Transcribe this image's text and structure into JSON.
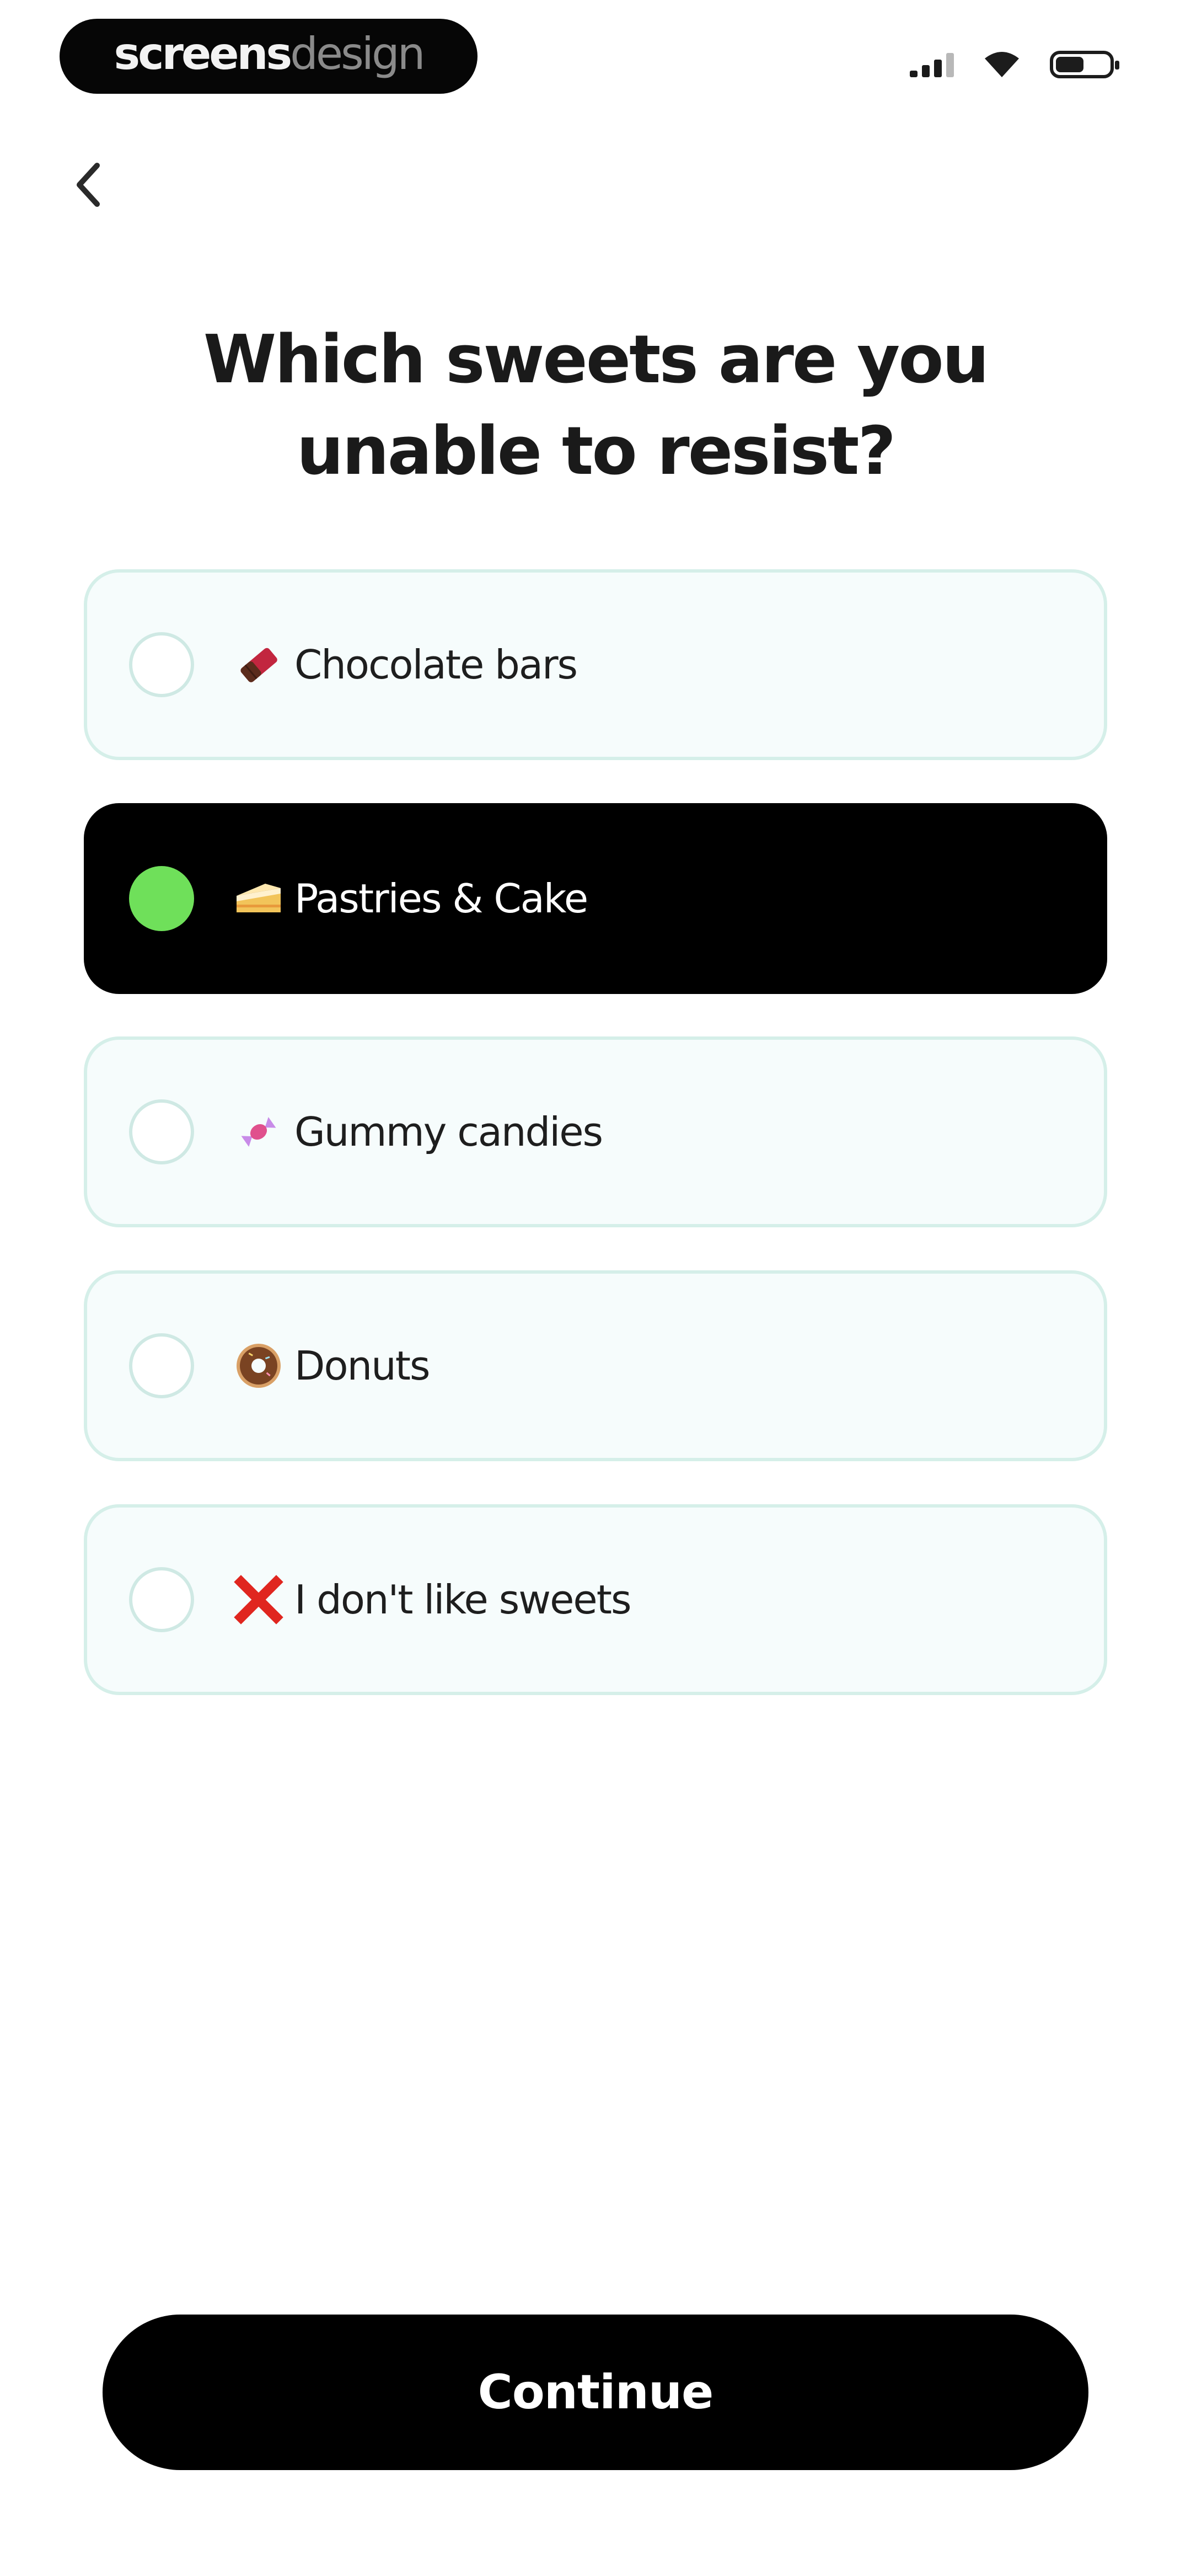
{
  "status_bar": {
    "brand_part1": "screens",
    "brand_part2": "design"
  },
  "question": "Which sweets are you unable to resist?",
  "options": [
    {
      "label": "Chocolate bars",
      "icon": "chocolate-bar-icon",
      "selected": false
    },
    {
      "label": "Pastries & Cake",
      "icon": "cake-slice-icon",
      "selected": true
    },
    {
      "label": "Gummy candies",
      "icon": "candy-icon",
      "selected": false
    },
    {
      "label": "Donuts",
      "icon": "donut-icon",
      "selected": false
    },
    {
      "label": "I don't like sweets",
      "icon": "cross-mark-icon",
      "selected": false
    }
  ],
  "continue_label": "Continue",
  "colors": {
    "accent_green": "#6fe05a",
    "option_border": "#d5efe9",
    "option_bg": "#f6fcfc",
    "selected_bg": "#000000"
  }
}
